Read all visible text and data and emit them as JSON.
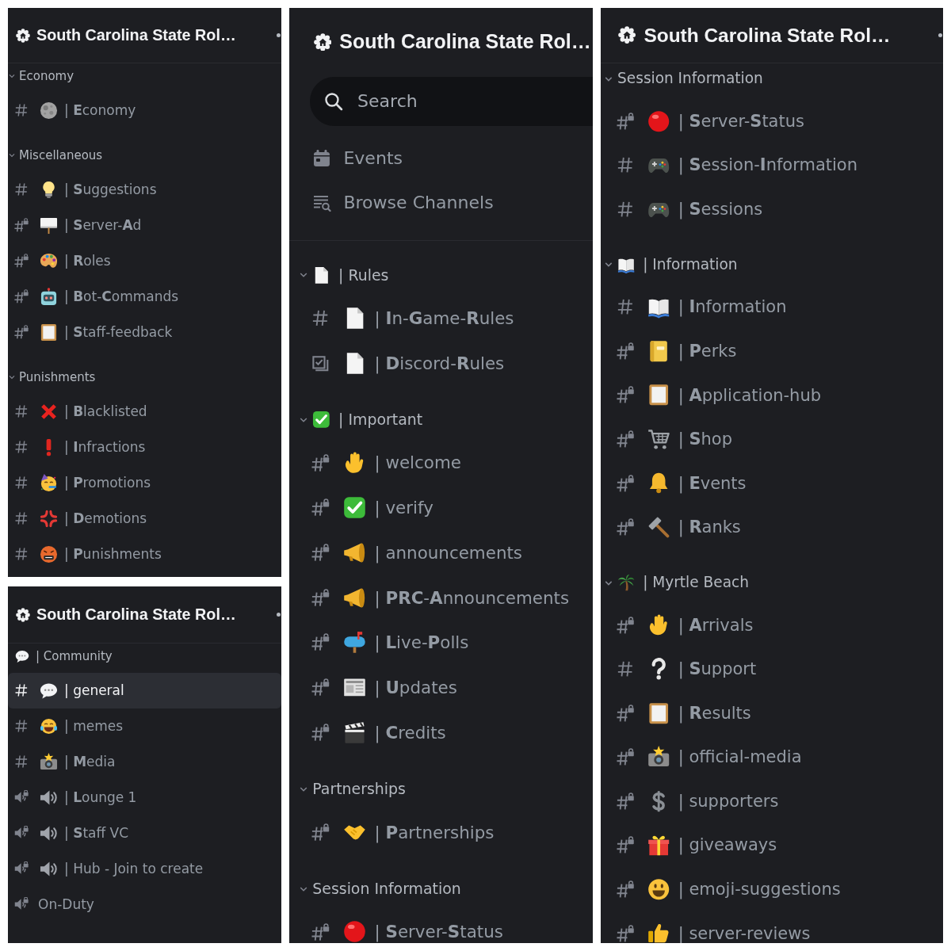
{
  "panels": [
    {
      "server": {
        "name": "South Carolina State Rol…"
      },
      "categories": [
        {
          "name": "Economy",
          "expanded": true,
          "channels": [
            {
              "kind": "text",
              "emoji": {
                "kind": "moon"
              },
              "name": "| **E**conomy",
              "selected": false
            }
          ]
        },
        {
          "name": "Miscellaneous",
          "expanded": true,
          "channels": [
            {
              "kind": "text",
              "emoji": {
                "kind": "lightbulb"
              },
              "name": "| **S**uggestions",
              "selected": false
            },
            {
              "kind": "locked",
              "emoji": {
                "kind": "sign"
              },
              "name": "| **S**erver-**A**d",
              "selected": false
            },
            {
              "kind": "locked",
              "emoji": {
                "kind": "palette"
              },
              "name": "| **R**oles",
              "selected": false
            },
            {
              "kind": "locked",
              "emoji": {
                "kind": "robot"
              },
              "name": "| **B**ot-**C**ommands",
              "selected": false
            },
            {
              "kind": "locked",
              "emoji": {
                "kind": "frame"
              },
              "name": "| **S**taff-feedback",
              "selected": false
            }
          ]
        },
        {
          "name": "Punishments",
          "expanded": true,
          "channels": [
            {
              "kind": "text",
              "emoji": {
                "kind": "cross"
              },
              "name": "| **B**lacklisted",
              "selected": false
            },
            {
              "kind": "text",
              "emoji": {
                "kind": "exclamation"
              },
              "name": "| **I**nfractions",
              "selected": false
            },
            {
              "kind": "text",
              "emoji": {
                "kind": "party-face"
              },
              "name": "| **P**romotions",
              "selected": false
            },
            {
              "kind": "text",
              "emoji": {
                "kind": "anger"
              },
              "name": "| **D**emotions",
              "selected": false
            },
            {
              "kind": "text",
              "emoji": {
                "kind": "angry-face"
              },
              "name": "| **P**unishments",
              "selected": false
            }
          ]
        }
      ]
    },
    {
      "server": {
        "name": "South Carolina State Rol…"
      },
      "categories": [
        {
          "emoji": {
            "kind": "speech-bubble"
          },
          "name": "| Community",
          "channels": [
            {
              "kind": "text",
              "emoji": {
                "kind": "speech-bubble"
              },
              "name": "| general",
              "selected": true
            },
            {
              "kind": "text",
              "emoji": {
                "kind": "laughing-face"
              },
              "name": "| memes",
              "selected": false
            },
            {
              "kind": "text",
              "emoji": {
                "kind": "camera"
              },
              "name": "| **M**edia",
              "selected": false
            },
            {
              "kind": "voice-locked",
              "emoji": {
                "kind": "speaker"
              },
              "name": "| **L**ounge 1",
              "selected": false
            },
            {
              "kind": "voice-locked",
              "emoji": {
                "kind": "speaker"
              },
              "name": "| **S**taff VC",
              "selected": false
            },
            {
              "kind": "voice-locked",
              "emoji": {
                "kind": "speaker"
              },
              "name": "| Hub - Join to create",
              "selected": false
            },
            {
              "kind": "voice-locked",
              "name": "On-Duty",
              "selected": false
            }
          ]
        }
      ]
    },
    {
      "server": {
        "name": "South Carolina State Rol…"
      },
      "search": {
        "placeholder": "Search"
      },
      "shortcuts": [
        {
          "kind": "events",
          "label": "Events"
        },
        {
          "kind": "browse",
          "label": "Browse Channels"
        }
      ],
      "categories": [
        {
          "name": "| Rules",
          "emoji": {
            "kind": "page"
          },
          "expanded": true,
          "channels": [
            {
              "kind": "text",
              "emoji": {
                "kind": "page"
              },
              "name": "| **I**n-**G**ame-**R**ules",
              "selected": false
            },
            {
              "kind": "rules",
              "emoji": {
                "kind": "page"
              },
              "name": "| **D**iscord-**R**ules",
              "selected": false
            }
          ]
        },
        {
          "name": "| Important",
          "emoji": {
            "kind": "check-box"
          },
          "expanded": true,
          "channels": [
            {
              "kind": "locked",
              "emoji": {
                "kind": "hand"
              },
              "name": "| welcome",
              "selected": false
            },
            {
              "kind": "locked",
              "emoji": {
                "kind": "check-box"
              },
              "name": "| verify",
              "selected": false
            },
            {
              "kind": "locked",
              "emoji": {
                "kind": "megaphone"
              },
              "name": "| announcements",
              "selected": false
            },
            {
              "kind": "locked",
              "emoji": {
                "kind": "megaphone"
              },
              "name": "| **PRC**-**A**nnouncements",
              "selected": false
            },
            {
              "kind": "locked",
              "emoji": {
                "kind": "mailbox"
              },
              "name": "| **L**ive-**P**olls",
              "selected": false
            },
            {
              "kind": "locked",
              "emoji": {
                "kind": "newspaper"
              },
              "name": "| **U**pdates",
              "selected": false
            },
            {
              "kind": "locked",
              "emoji": {
                "kind": "clapperboard"
              },
              "name": "| **C**redits",
              "selected": false
            }
          ]
        },
        {
          "name": "Partnerships",
          "expanded": true,
          "channels": [
            {
              "kind": "locked",
              "emoji": {
                "kind": "handshake"
              },
              "name": "| **P**artnerships",
              "selected": false
            }
          ]
        },
        {
          "name": "Session Information",
          "expanded": true,
          "channels": [
            {
              "kind": "locked",
              "emoji": {
                "kind": "circle"
              },
              "name": "| **S**erver-**S**tatus",
              "selected": false
            }
          ]
        }
      ]
    },
    {
      "server": {
        "name": "South Carolina State Rol…"
      },
      "categories": [
        {
          "name": "Session Information",
          "expanded": true,
          "channels": [
            {
              "kind": "locked",
              "emoji": {
                "kind": "circle"
              },
              "name": "| **S**erver-**S**tatus",
              "selected": false
            },
            {
              "kind": "text",
              "emoji": {
                "kind": "gamepad"
              },
              "name": "| **S**ession-**I**nformation",
              "selected": false
            },
            {
              "kind": "text",
              "emoji": {
                "kind": "gamepad"
              },
              "name": "| **S**essions",
              "selected": false
            }
          ]
        },
        {
          "name": "| Information",
          "emoji": {
            "kind": "book"
          },
          "expanded": true,
          "channels": [
            {
              "kind": "text",
              "emoji": {
                "kind": "book"
              },
              "name": "| **I**nformation",
              "selected": false
            },
            {
              "kind": "locked",
              "emoji": {
                "kind": "notebook"
              },
              "name": "| **P**erks",
              "selected": false
            },
            {
              "kind": "locked",
              "emoji": {
                "kind": "frame"
              },
              "name": "| **A**pplication-hub",
              "selected": false
            },
            {
              "kind": "locked",
              "emoji": {
                "kind": "cart"
              },
              "name": "| **S**hop",
              "selected": false
            },
            {
              "kind": "locked",
              "emoji": {
                "kind": "bell"
              },
              "name": "| **E**vents",
              "selected": false
            },
            {
              "kind": "locked",
              "emoji": {
                "kind": "hammer"
              },
              "name": "| **R**anks",
              "selected": false
            }
          ]
        },
        {
          "name": "| Myrtle Beach",
          "emoji": {
            "kind": "palm-tree"
          },
          "expanded": true,
          "channels": [
            {
              "kind": "locked",
              "emoji": {
                "kind": "hand"
              },
              "name": "| **A**rrivals",
              "selected": false
            },
            {
              "kind": "text",
              "emoji": {
                "kind": "question"
              },
              "name": "| **S**upport",
              "selected": false
            },
            {
              "kind": "locked",
              "emoji": {
                "kind": "frame"
              },
              "name": "| **R**esults",
              "selected": false
            },
            {
              "kind": "locked",
              "emoji": {
                "kind": "camera"
              },
              "name": "| official-media",
              "selected": false
            },
            {
              "kind": "locked",
              "emoji": {
                "kind": "dollar"
              },
              "name": "| supporters",
              "selected": false
            },
            {
              "kind": "locked",
              "emoji": {
                "kind": "gift"
              },
              "name": "| giveaways",
              "selected": false
            },
            {
              "kind": "locked",
              "emoji": {
                "kind": "smiley"
              },
              "name": "| emoji-suggestions",
              "selected": false
            },
            {
              "kind": "locked",
              "emoji": {
                "kind": "thumbs-up"
              },
              "name": "| server-reviews",
              "selected": false
            }
          ]
        }
      ]
    }
  ]
}
